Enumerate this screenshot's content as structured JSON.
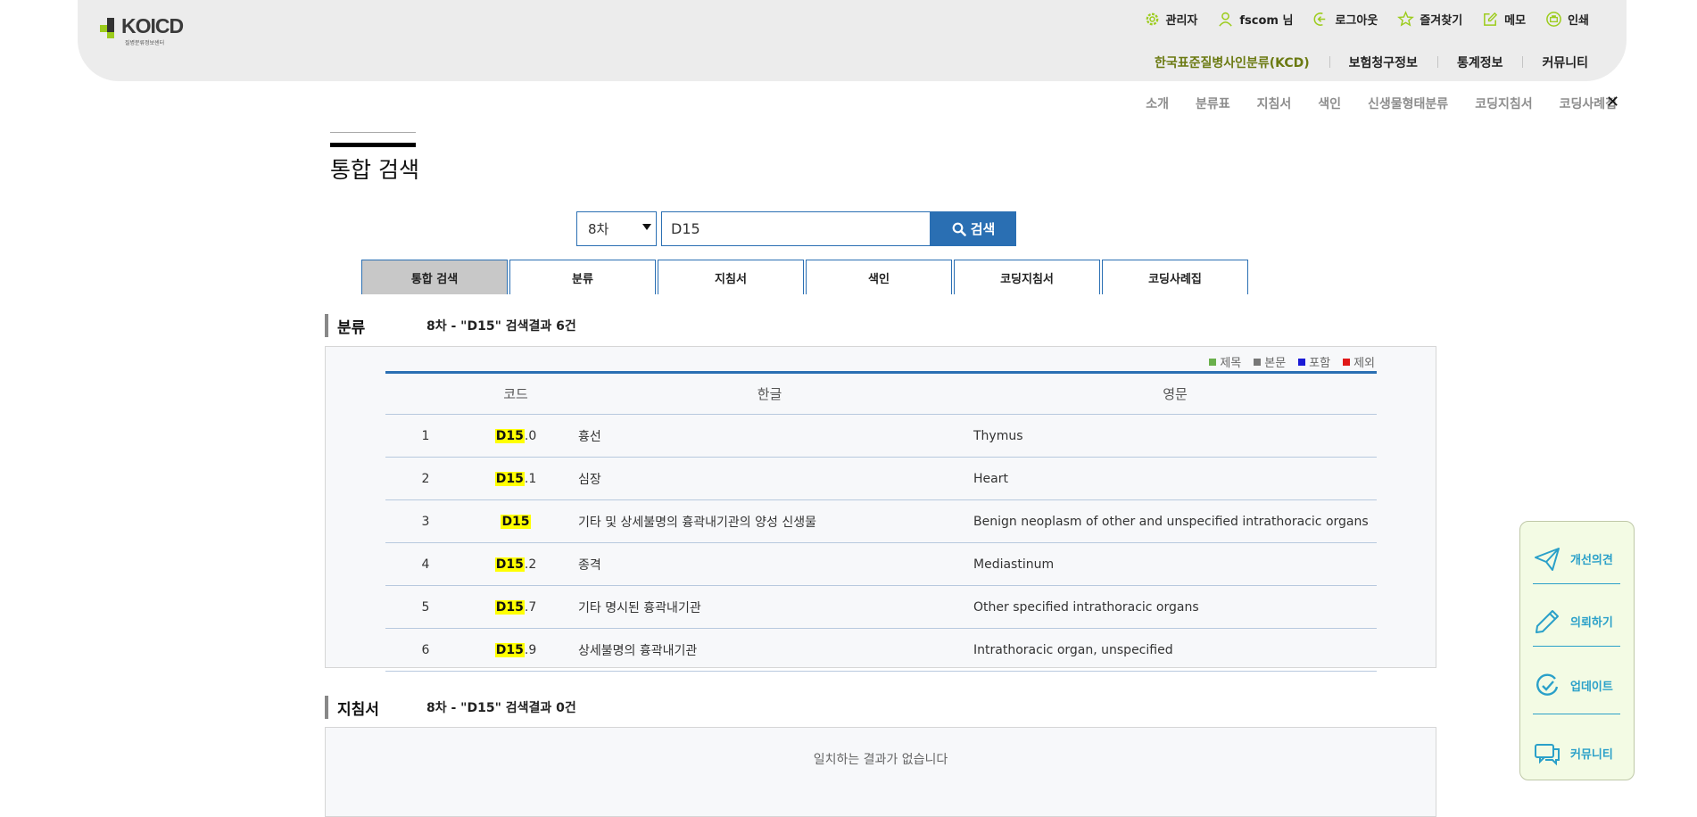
{
  "header": {
    "logo_word": "KOICD",
    "logo_sub": "질병분류정보센터",
    "util": [
      {
        "icon": "gear-icon",
        "label": "관리자"
      },
      {
        "icon": "user-icon",
        "label": "fscom 님"
      },
      {
        "icon": "logout-icon",
        "label": "로그아웃"
      },
      {
        "icon": "star-icon",
        "label": "즐겨찾기"
      },
      {
        "icon": "memo-icon",
        "label": "메모"
      },
      {
        "icon": "print-icon",
        "label": "인쇄"
      }
    ],
    "gnb": [
      "한국표준질병사인분류(KCD)",
      "보험청구정보",
      "통계정보",
      "커뮤니티"
    ]
  },
  "subnav": [
    "소개",
    "분류표",
    "지침서",
    "색인",
    "신생물형태분류",
    "코딩지침서",
    "코딩사례집"
  ],
  "subnav_close": "✕",
  "page_title": "통합 검색",
  "search": {
    "version": "8차",
    "query": "D15",
    "button_label": "검색"
  },
  "tabs": [
    "통합 검색",
    "분류",
    "지침서",
    "색인",
    "코딩지침서",
    "코딩사례집"
  ],
  "classification": {
    "title": "분류",
    "count_text": "8차 - \"D15\" 검색결과 6건",
    "legend": [
      {
        "label": "제목",
        "color": "#6ab04c"
      },
      {
        "label": "본문",
        "color": "#777777"
      },
      {
        "label": "포함",
        "color": "#1a1ad6"
      },
      {
        "label": "제외",
        "color": "#e01818"
      }
    ],
    "columns": [
      "코드",
      "한글",
      "영문"
    ],
    "rows": [
      {
        "no": "1",
        "code_hl": "D15",
        "code_rest": ".0",
        "kr": "흉선",
        "en": "Thymus"
      },
      {
        "no": "2",
        "code_hl": "D15",
        "code_rest": ".1",
        "kr": "심장",
        "en": "Heart"
      },
      {
        "no": "3",
        "code_hl": "D15",
        "code_rest": "",
        "kr": "기타 및 상세불명의 흉곽내기관의 양성 신생물",
        "en": "Benign neoplasm of other and unspecified intrathoracic organs"
      },
      {
        "no": "4",
        "code_hl": "D15",
        "code_rest": ".2",
        "kr": "종격",
        "en": "Mediastinum"
      },
      {
        "no": "5",
        "code_hl": "D15",
        "code_rest": ".7",
        "kr": "기타 명시된 흉곽내기관",
        "en": "Other specified intrathoracic organs"
      },
      {
        "no": "6",
        "code_hl": "D15",
        "code_rest": ".9",
        "kr": "상세불명의 흉곽내기관",
        "en": "Intrathoracic organ, unspecified"
      }
    ]
  },
  "guideline": {
    "title": "지침서",
    "count_text": "8차 - \"D15\" 검색결과 0건",
    "empty_text": "일치하는 결과가 없습니다"
  },
  "quick_menu": [
    {
      "icon": "paper-plane-icon",
      "label": "개선의견"
    },
    {
      "icon": "pencil-icon",
      "label": "의뢰하기"
    },
    {
      "icon": "update-icon",
      "label": "업데이트"
    },
    {
      "icon": "chat-icon",
      "label": "커뮤니티"
    }
  ]
}
